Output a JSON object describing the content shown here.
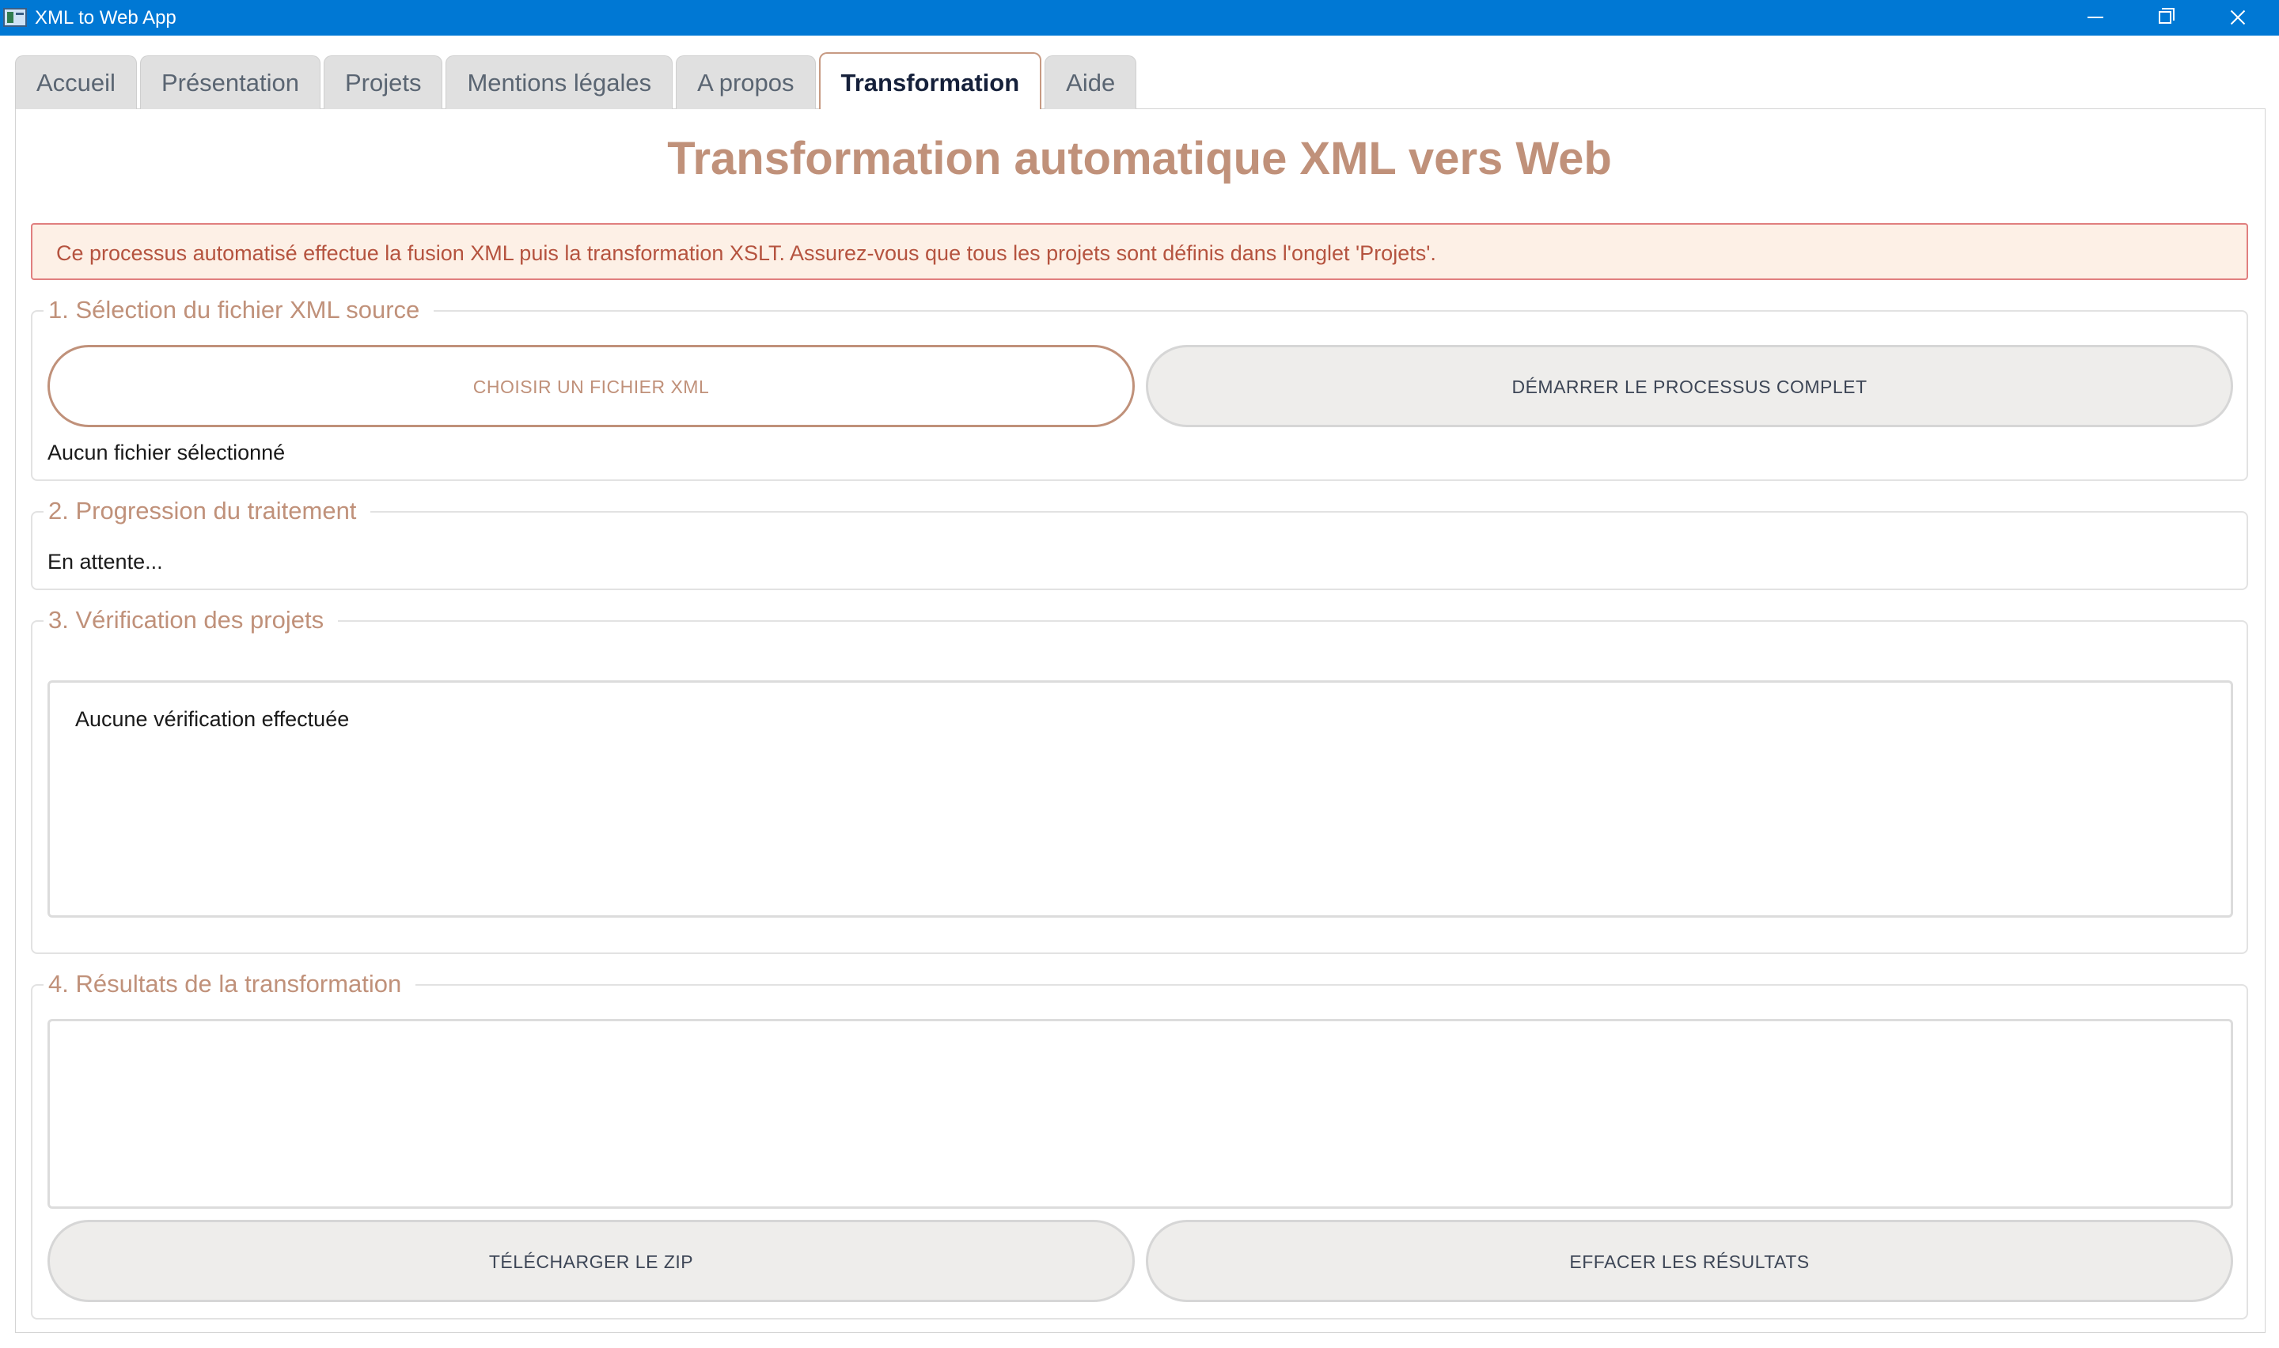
{
  "window": {
    "title": "XML to Web App",
    "icon": "app-icon",
    "controls": [
      "minimize-icon",
      "maximize-icon",
      "close-icon"
    ]
  },
  "tabs": [
    {
      "label": "Accueil"
    },
    {
      "label": "Présentation"
    },
    {
      "label": "Projets"
    },
    {
      "label": "Mentions légales"
    },
    {
      "label": "A propos"
    },
    {
      "label": "Transformation",
      "active": true
    },
    {
      "label": "Aide"
    }
  ],
  "page": {
    "title": "Transformation automatique XML vers Web",
    "info": "Ce processus automatisé effectue la fusion XML puis la transformation XSLT. Assurez-vous que tous les projets sont définis dans l'onglet 'Projets'."
  },
  "sections": {
    "selection": {
      "legend": "1. Sélection du fichier XML source",
      "choose_label": "CHOISIR UN FICHIER XML",
      "start_label": "DÉMARRER LE PROCESSUS COMPLET",
      "file_status": "Aucun fichier sélectionné"
    },
    "progress": {
      "legend": "2. Progression du traitement",
      "status": "En attente..."
    },
    "verification": {
      "legend": "3. Vérification des projets",
      "text": "Aucune vérification effectuée"
    },
    "results": {
      "legend": "4. Résultats de la transformation",
      "content": "",
      "download_label": "TÉLÉCHARGER LE ZIP",
      "clear_label": "EFFACER LES RÉSULTATS"
    }
  },
  "colors": {
    "titlebar": "#0078d4",
    "accent": "#c0917a",
    "info_bg": "#fdf0e6",
    "info_border": "#e07f7f",
    "info_text": "#b5533f"
  }
}
